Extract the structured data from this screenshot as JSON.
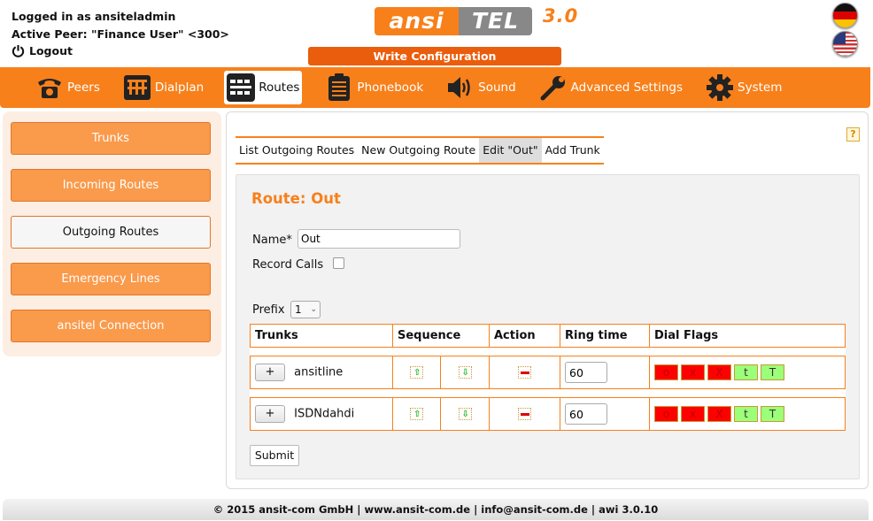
{
  "header": {
    "logged_in": "Logged in as ansiteladmin",
    "active_peer": "Active Peer: \"Finance User\" <300>",
    "logout": "Logout",
    "logo_part1": "ansi",
    "logo_part2": "TEL",
    "logo_version": "3.0",
    "write_config": "Write Configuration",
    "languages": [
      "German",
      "English"
    ]
  },
  "nav": {
    "items": [
      {
        "label": "Peers",
        "icon": "telephone-icon"
      },
      {
        "label": "Dialplan",
        "icon": "dialplan-icon"
      },
      {
        "label": "Routes",
        "icon": "routes-icon",
        "active": true
      },
      {
        "label": "Phonebook",
        "icon": "phonebook-icon"
      },
      {
        "label": "Sound",
        "icon": "speaker-icon"
      },
      {
        "label": "Advanced Settings",
        "icon": "wrench-icon"
      },
      {
        "label": "System",
        "icon": "gear-icon"
      }
    ]
  },
  "sidebar": {
    "items": [
      {
        "label": "Trunks"
      },
      {
        "label": "Incoming Routes"
      },
      {
        "label": "Outgoing Routes",
        "active": true
      },
      {
        "label": "Emergency Lines"
      },
      {
        "label": "ansitel Connection"
      }
    ]
  },
  "tabs": [
    {
      "label": "List Outgoing Routes"
    },
    {
      "label": "New Outgoing Route"
    },
    {
      "label": "Edit \"Out\"",
      "active": true
    },
    {
      "label": "Add Trunk"
    }
  ],
  "help_label": "?",
  "form": {
    "title": "Route: Out",
    "name_label": "Name",
    "name_required": "*",
    "name_value": "Out",
    "record_label": "Record Calls",
    "record_checked": false,
    "prefix_label": "Prefix",
    "prefix_value": "1",
    "submit_label": "Submit"
  },
  "table": {
    "headers": [
      "Trunks",
      "Sequence",
      "Action",
      "Ring time",
      "Dial Flags"
    ],
    "plus_label": "+",
    "rows": [
      {
        "trunk": "ansitline",
        "ring_time": "60"
      },
      {
        "trunk": "ISDNdahdi",
        "ring_time": "60"
      }
    ],
    "dial_flags": [
      {
        "label": "o",
        "color": "#ff0000"
      },
      {
        "label": "x",
        "color": "#ff0000"
      },
      {
        "label": "X",
        "color": "#ff0000"
      },
      {
        "label": "t",
        "color": "#9cff7a"
      },
      {
        "label": "T",
        "color": "#9cff7a"
      }
    ]
  },
  "footer": "© 2015 ansit-com GmbH | www.ansit-com.de | info@ansit-com.de | awi 3.0.10",
  "colors": {
    "accent": "#f7801b",
    "button_dark": "#ea5d0c",
    "flag_off": "#ff0000",
    "flag_on": "#9cff7a"
  }
}
